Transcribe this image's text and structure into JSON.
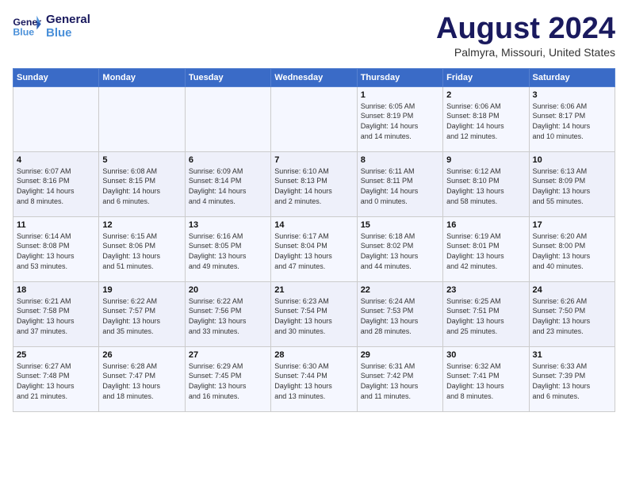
{
  "logo": {
    "line1": "General",
    "line2": "Blue"
  },
  "title": {
    "month_year": "August 2024",
    "location": "Palmyra, Missouri, United States"
  },
  "days_of_week": [
    "Sunday",
    "Monday",
    "Tuesday",
    "Wednesday",
    "Thursday",
    "Friday",
    "Saturday"
  ],
  "weeks": [
    [
      {
        "day": "",
        "info": ""
      },
      {
        "day": "",
        "info": ""
      },
      {
        "day": "",
        "info": ""
      },
      {
        "day": "",
        "info": ""
      },
      {
        "day": "1",
        "info": "Sunrise: 6:05 AM\nSunset: 8:19 PM\nDaylight: 14 hours\nand 14 minutes."
      },
      {
        "day": "2",
        "info": "Sunrise: 6:06 AM\nSunset: 8:18 PM\nDaylight: 14 hours\nand 12 minutes."
      },
      {
        "day": "3",
        "info": "Sunrise: 6:06 AM\nSunset: 8:17 PM\nDaylight: 14 hours\nand 10 minutes."
      }
    ],
    [
      {
        "day": "4",
        "info": "Sunrise: 6:07 AM\nSunset: 8:16 PM\nDaylight: 14 hours\nand 8 minutes."
      },
      {
        "day": "5",
        "info": "Sunrise: 6:08 AM\nSunset: 8:15 PM\nDaylight: 14 hours\nand 6 minutes."
      },
      {
        "day": "6",
        "info": "Sunrise: 6:09 AM\nSunset: 8:14 PM\nDaylight: 14 hours\nand 4 minutes."
      },
      {
        "day": "7",
        "info": "Sunrise: 6:10 AM\nSunset: 8:13 PM\nDaylight: 14 hours\nand 2 minutes."
      },
      {
        "day": "8",
        "info": "Sunrise: 6:11 AM\nSunset: 8:11 PM\nDaylight: 14 hours\nand 0 minutes."
      },
      {
        "day": "9",
        "info": "Sunrise: 6:12 AM\nSunset: 8:10 PM\nDaylight: 13 hours\nand 58 minutes."
      },
      {
        "day": "10",
        "info": "Sunrise: 6:13 AM\nSunset: 8:09 PM\nDaylight: 13 hours\nand 55 minutes."
      }
    ],
    [
      {
        "day": "11",
        "info": "Sunrise: 6:14 AM\nSunset: 8:08 PM\nDaylight: 13 hours\nand 53 minutes."
      },
      {
        "day": "12",
        "info": "Sunrise: 6:15 AM\nSunset: 8:06 PM\nDaylight: 13 hours\nand 51 minutes."
      },
      {
        "day": "13",
        "info": "Sunrise: 6:16 AM\nSunset: 8:05 PM\nDaylight: 13 hours\nand 49 minutes."
      },
      {
        "day": "14",
        "info": "Sunrise: 6:17 AM\nSunset: 8:04 PM\nDaylight: 13 hours\nand 47 minutes."
      },
      {
        "day": "15",
        "info": "Sunrise: 6:18 AM\nSunset: 8:02 PM\nDaylight: 13 hours\nand 44 minutes."
      },
      {
        "day": "16",
        "info": "Sunrise: 6:19 AM\nSunset: 8:01 PM\nDaylight: 13 hours\nand 42 minutes."
      },
      {
        "day": "17",
        "info": "Sunrise: 6:20 AM\nSunset: 8:00 PM\nDaylight: 13 hours\nand 40 minutes."
      }
    ],
    [
      {
        "day": "18",
        "info": "Sunrise: 6:21 AM\nSunset: 7:58 PM\nDaylight: 13 hours\nand 37 minutes."
      },
      {
        "day": "19",
        "info": "Sunrise: 6:22 AM\nSunset: 7:57 PM\nDaylight: 13 hours\nand 35 minutes."
      },
      {
        "day": "20",
        "info": "Sunrise: 6:22 AM\nSunset: 7:56 PM\nDaylight: 13 hours\nand 33 minutes."
      },
      {
        "day": "21",
        "info": "Sunrise: 6:23 AM\nSunset: 7:54 PM\nDaylight: 13 hours\nand 30 minutes."
      },
      {
        "day": "22",
        "info": "Sunrise: 6:24 AM\nSunset: 7:53 PM\nDaylight: 13 hours\nand 28 minutes."
      },
      {
        "day": "23",
        "info": "Sunrise: 6:25 AM\nSunset: 7:51 PM\nDaylight: 13 hours\nand 25 minutes."
      },
      {
        "day": "24",
        "info": "Sunrise: 6:26 AM\nSunset: 7:50 PM\nDaylight: 13 hours\nand 23 minutes."
      }
    ],
    [
      {
        "day": "25",
        "info": "Sunrise: 6:27 AM\nSunset: 7:48 PM\nDaylight: 13 hours\nand 21 minutes."
      },
      {
        "day": "26",
        "info": "Sunrise: 6:28 AM\nSunset: 7:47 PM\nDaylight: 13 hours\nand 18 minutes."
      },
      {
        "day": "27",
        "info": "Sunrise: 6:29 AM\nSunset: 7:45 PM\nDaylight: 13 hours\nand 16 minutes."
      },
      {
        "day": "28",
        "info": "Sunrise: 6:30 AM\nSunset: 7:44 PM\nDaylight: 13 hours\nand 13 minutes."
      },
      {
        "day": "29",
        "info": "Sunrise: 6:31 AM\nSunset: 7:42 PM\nDaylight: 13 hours\nand 11 minutes."
      },
      {
        "day": "30",
        "info": "Sunrise: 6:32 AM\nSunset: 7:41 PM\nDaylight: 13 hours\nand 8 minutes."
      },
      {
        "day": "31",
        "info": "Sunrise: 6:33 AM\nSunset: 7:39 PM\nDaylight: 13 hours\nand 6 minutes."
      }
    ]
  ]
}
